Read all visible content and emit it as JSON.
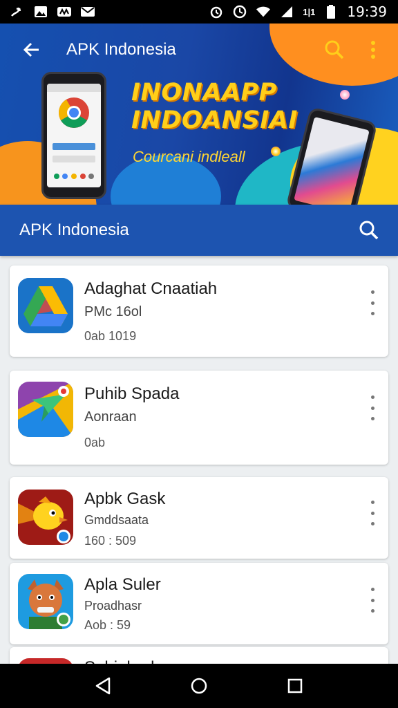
{
  "status_bar": {
    "time": "19:39",
    "signal_text": "1|1"
  },
  "banner": {
    "title": "APK Indonesia",
    "headline_line1": "INONAAPP",
    "headline_line2": "INDOANSIAI",
    "tagline": "Courcani indleall"
  },
  "app_bar": {
    "title": "APK Indonesia"
  },
  "apps": [
    {
      "name": "Adaghat Cnaatiah",
      "subtitle": "PMc 16ol",
      "meta": "0ab 1019",
      "icon": "drive-icon"
    },
    {
      "name": "Puhib Spada",
      "subtitle": "Aonraan",
      "meta": "0ab",
      "icon": "plane-icon"
    },
    {
      "name": "Apbk Gask",
      "subtitle": "Gmddsaata",
      "meta": "160 : 509",
      "icon": "bird-icon"
    },
    {
      "name": "Apla Suler",
      "subtitle": "Proadhasr",
      "meta": "Aob : 59",
      "icon": "cat-icon"
    },
    {
      "name": "Sabiahrak",
      "subtitle": "",
      "meta": "",
      "icon": "app-icon"
    }
  ],
  "colors": {
    "primary": "#1d54b0",
    "accent": "#ffcf1a",
    "background": "#eceff1"
  }
}
